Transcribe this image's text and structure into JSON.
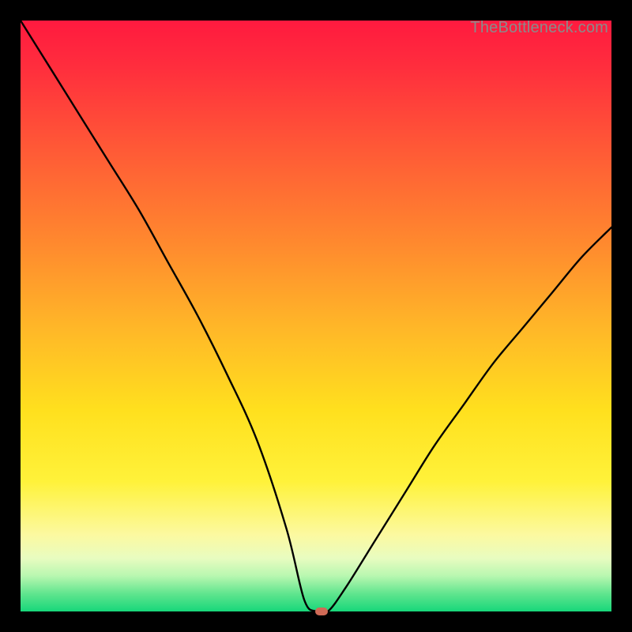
{
  "watermark": "TheBottleneck.com",
  "chart_data": {
    "type": "line",
    "title": "",
    "xlabel": "",
    "ylabel": "",
    "xlim": [
      0,
      100
    ],
    "ylim": [
      0,
      100
    ],
    "series": [
      {
        "name": "bottleneck-curve",
        "x": [
          0,
          5,
          10,
          15,
          20,
          25,
          30,
          35,
          40,
          45,
          48,
          50,
          52,
          55,
          60,
          65,
          70,
          75,
          80,
          85,
          90,
          95,
          100
        ],
        "y": [
          100,
          92,
          84,
          76,
          68,
          59,
          50,
          40,
          29,
          14,
          2,
          0,
          0,
          4,
          12,
          20,
          28,
          35,
          42,
          48,
          54,
          60,
          65
        ]
      }
    ],
    "marker": {
      "x": 51,
      "y": 0
    },
    "gradient_stops": [
      {
        "pos": 0,
        "color": "#ff1a3f"
      },
      {
        "pos": 50,
        "color": "#ffb728"
      },
      {
        "pos": 80,
        "color": "#fff23a"
      },
      {
        "pos": 100,
        "color": "#17d77a"
      }
    ]
  }
}
